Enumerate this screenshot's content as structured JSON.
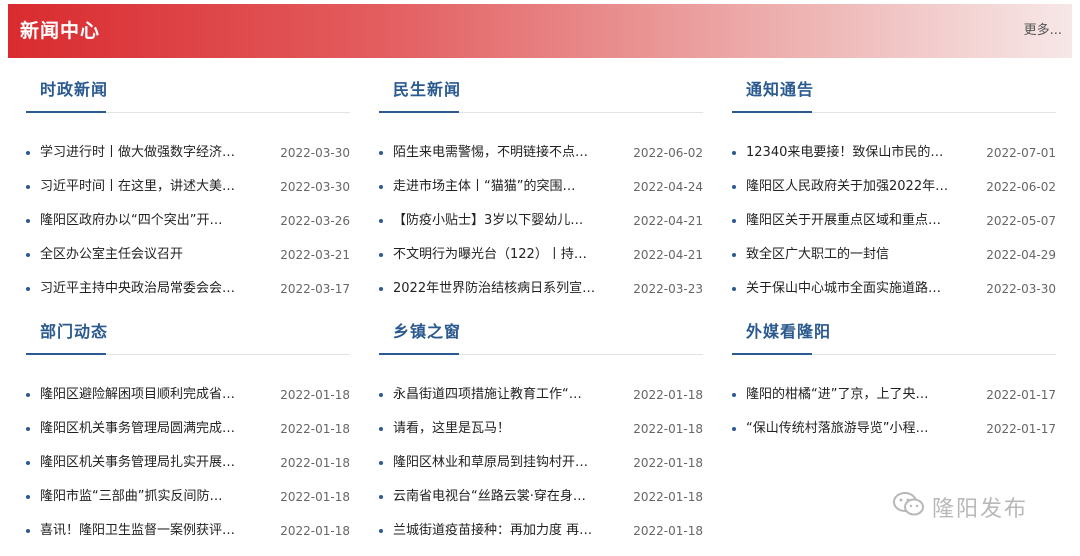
{
  "header": {
    "title": "新闻中心",
    "more": "更多..."
  },
  "sections": [
    {
      "title": "时政新闻",
      "items": [
        {
          "title": "学习进行时丨做大做强数字经济…",
          "date": "2022-03-30"
        },
        {
          "title": "习近平时间丨在这里，讲述大美…",
          "date": "2022-03-30"
        },
        {
          "title": "隆阳区政府办以“四个突出”开…",
          "date": "2022-03-26"
        },
        {
          "title": "全区办公室主任会议召开",
          "date": "2022-03-21"
        },
        {
          "title": "习近平主持中央政治局常委会会…",
          "date": "2022-03-17"
        }
      ]
    },
    {
      "title": "民生新闻",
      "items": [
        {
          "title": "陌生来电需警惕，不明链接不点…",
          "date": "2022-06-02"
        },
        {
          "title": "走进市场主体丨“猫猫”的突围…",
          "date": "2022-04-24"
        },
        {
          "title": "【防疫小贴士】3岁以下婴幼儿…",
          "date": "2022-04-21"
        },
        {
          "title": "不文明行为曝光台（122）丨持…",
          "date": "2022-04-21"
        },
        {
          "title": "2022年世界防治结核病日系列宣…",
          "date": "2022-03-23"
        }
      ]
    },
    {
      "title": "通知通告",
      "items": [
        {
          "title": "12340来电要接！致保山市民的…",
          "date": "2022-07-01"
        },
        {
          "title": "隆阳区人民政府关于加强2022年…",
          "date": "2022-06-02"
        },
        {
          "title": "隆阳区关于开展重点区域和重点…",
          "date": "2022-05-07"
        },
        {
          "title": "致全区广大职工的一封信",
          "date": "2022-04-29"
        },
        {
          "title": "关于保山中心城市全面实施道路…",
          "date": "2022-03-30"
        }
      ]
    },
    {
      "title": "部门动态",
      "items": [
        {
          "title": "隆阳区避险解困项目顺利完成省…",
          "date": "2022-01-18"
        },
        {
          "title": "隆阳区机关事务管理局圆满完成…",
          "date": "2022-01-18"
        },
        {
          "title": "隆阳区机关事务管理局扎实开展…",
          "date": "2022-01-18"
        },
        {
          "title": "隆阳市监“三部曲”抓实反间防…",
          "date": "2022-01-18"
        },
        {
          "title": "喜讯！隆阳卫生监督一案例获评…",
          "date": "2022-01-18"
        }
      ]
    },
    {
      "title": "乡镇之窗",
      "items": [
        {
          "title": "永昌街道四项措施让教育工作“…",
          "date": "2022-01-18"
        },
        {
          "title": "请看，这里是瓦马！",
          "date": "2022-01-18"
        },
        {
          "title": "隆阳区林业和草原局到挂钩村开…",
          "date": "2022-01-18"
        },
        {
          "title": "云南省电视台“丝路云裳·穿在身…",
          "date": "2022-01-18"
        },
        {
          "title": "兰城街道疫苗接种：再加力度 再…",
          "date": "2022-01-18"
        }
      ]
    },
    {
      "title": "外媒看隆阳",
      "items": [
        {
          "title": "隆阳的柑橘“进”了京，上了央…",
          "date": "2022-01-17"
        },
        {
          "title": "“保山传统村落旅游导览”小程…",
          "date": "2022-01-17"
        }
      ]
    }
  ],
  "watermark": {
    "text": "隆阳发布",
    "icon": "wechat-icon"
  }
}
